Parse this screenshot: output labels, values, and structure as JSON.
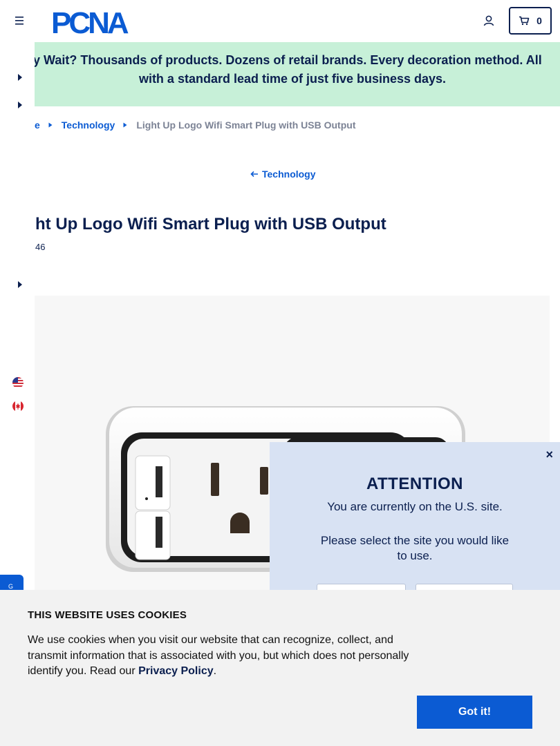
{
  "header": {
    "logo_text": "PCNA",
    "cart_count": "0"
  },
  "promo": {
    "line1": "y Wait? Thousands of products. Dozens of retail brands. Every decoration method. All",
    "line2": "with a standard lead time of just five business days."
  },
  "breadcrumb": {
    "home": "e",
    "category": "Technology",
    "current": "Light Up Logo Wifi Smart Plug with USB Output"
  },
  "back_link": {
    "label": "Technology"
  },
  "product": {
    "title": "ht Up Logo Wifi Smart Plug with USB Output",
    "item_number": "46"
  },
  "attention": {
    "close": "×",
    "title": "ATTENTION",
    "message": "You are currently on the U.S. site.",
    "prompt": "Please select the site you would like to use."
  },
  "cookies": {
    "title": "THIS WEBSITE USES COOKIES",
    "body": "We use cookies when you visit our website that can recognize, collect, and transmit information that is associated with you, but which does not personally identify you. Read our ",
    "link": "Privacy Policy",
    "tail": ".",
    "button": "Got it!"
  },
  "feedback_tab": {
    "label": "G"
  },
  "colors": {
    "brand_navy": "#0b1f4f",
    "link_blue": "#0b5bd3",
    "promo_green": "#c7f0d8",
    "modal_blue": "#d8e2f3"
  },
  "icons": [
    "hamburger-menu-icon",
    "user-account-icon",
    "shopping-cart-icon",
    "chevron-right-icon",
    "arrow-left-icon",
    "us-flag-icon",
    "canada-flag-icon",
    "close-icon"
  ]
}
